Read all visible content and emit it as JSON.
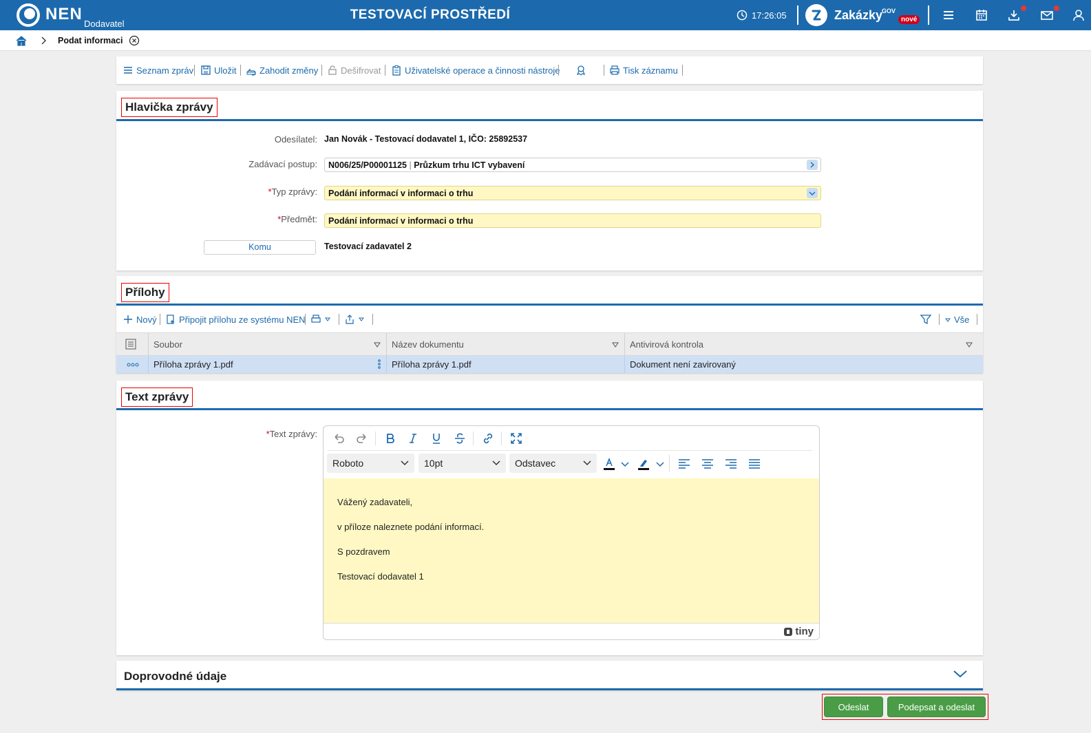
{
  "header": {
    "logo_text": "NEN",
    "logo_sub": "Dodavatel",
    "env_title": "TESTOVACÍ PROSTŘEDÍ",
    "time": "17:26:05",
    "zakazky": "Zakázky",
    "zakazky_gov": "GOV",
    "zakazky_new": "nové",
    "accent_color": "#1c6aad"
  },
  "breadcrumb": {
    "current": "Podat informaci"
  },
  "toolbar": {
    "items": [
      "Seznam zpráv",
      "Uložit",
      "Zahodit změny",
      "Dešifrovat",
      "Uživatelské operace a činnosti nástroje",
      "Tisk záznamu"
    ]
  },
  "header_section": {
    "title": "Hlavička zprávy",
    "sender_label": "Odesílatel:",
    "sender_value": "Jan Novák - Testovací dodavatel 1, IČO: 25892537",
    "procedure_label": "Zadávací postup:",
    "procedure_value": "N006/25/P00001125",
    "procedure_sep": "|",
    "procedure_name": "Průzkum trhu ICT vybavení",
    "type_label": "Typ zprávy:",
    "type_value": "Podání informací v informaci o trhu",
    "subject_label": "Předmět:",
    "subject_value": "Podání informací v informaci o trhu",
    "to_button": "Komu",
    "to_value": "Testovací zadavatel 2",
    "required_mark": "*"
  },
  "attachments": {
    "title": "Přílohy",
    "new_label": "Nový",
    "attach_label": "Připojit přílohu ze systému NEN",
    "all_label": "Vše",
    "columns": [
      "Soubor",
      "Název dokumentu",
      "Antivirová kontrola"
    ],
    "rows": [
      {
        "file": "Příloha zprávy 1.pdf",
        "name": "Příloha zprávy 1.pdf",
        "av": "Dokument není zavirovaný"
      }
    ]
  },
  "message": {
    "title": "Text zprávy",
    "label": "Text zprávy:",
    "font": "Roboto",
    "size": "10pt",
    "block": "Odstavec",
    "body": [
      "Vážený zadavateli,",
      "v příloze naleznete podání informací.",
      "S pozdravem",
      "Testovací dodavatel 1"
    ],
    "tiny": "tiny"
  },
  "extra": {
    "title": "Doprovodné údaje"
  },
  "actions": {
    "send": "Odeslat",
    "sign_send": "Podepsat a odeslat",
    "button_color": "#4a9d46"
  }
}
